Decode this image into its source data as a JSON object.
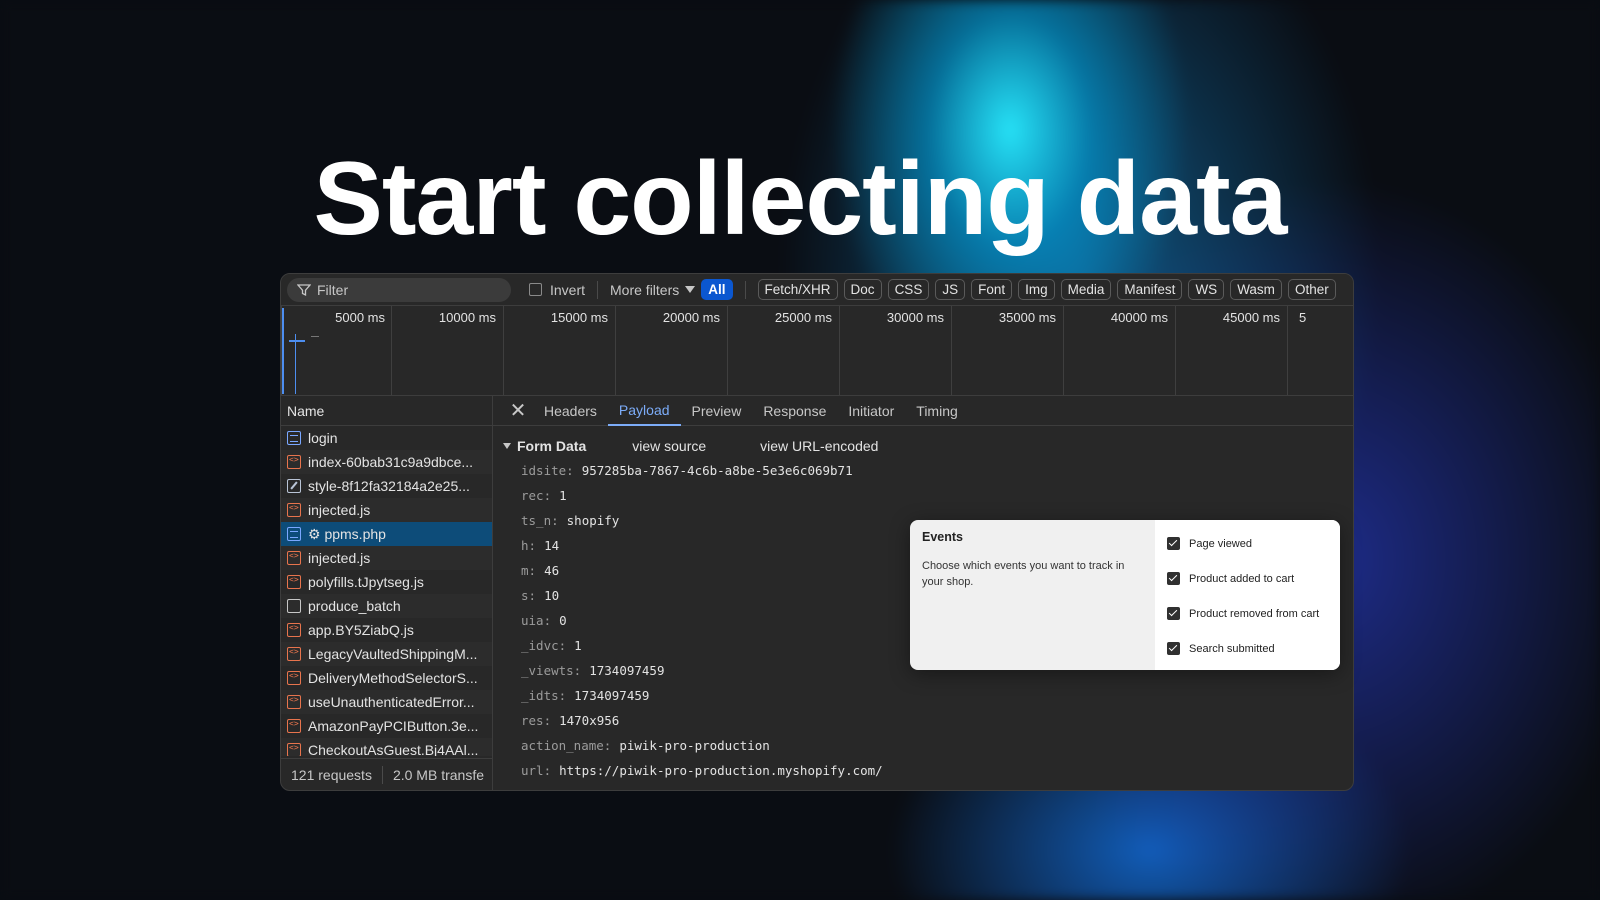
{
  "headline": "Start collecting data",
  "toolbar": {
    "filter_placeholder": "Filter",
    "invert_label": "Invert",
    "more_filters_label": "More filters",
    "chips": [
      "All",
      "Fetch/XHR",
      "Doc",
      "CSS",
      "JS",
      "Font",
      "Img",
      "Media",
      "Manifest",
      "WS",
      "Wasm",
      "Other"
    ]
  },
  "timeline": {
    "ticks": [
      "5000 ms",
      "10000 ms",
      "15000 ms",
      "20000 ms",
      "25000 ms",
      "30000 ms",
      "35000 ms",
      "40000 ms",
      "45000 ms",
      "5"
    ]
  },
  "requests": {
    "column_name": "Name",
    "items": [
      {
        "name": "login",
        "icon": "document-icon"
      },
      {
        "name": "index-60bab31c9a9dbce...",
        "icon": "script-icon"
      },
      {
        "name": "style-8f12fa32184a2e25...",
        "icon": "stylesheet-icon"
      },
      {
        "name": "injected.js",
        "icon": "script-icon"
      },
      {
        "name": "⚙ ppms.php",
        "icon": "document-icon",
        "selected": true
      },
      {
        "name": "injected.js",
        "icon": "script-icon"
      },
      {
        "name": "polyfills.tJpytseg.js",
        "icon": "script-icon"
      },
      {
        "name": "produce_batch",
        "icon": "blank-icon"
      },
      {
        "name": "app.BY5ZiabQ.js",
        "icon": "script-icon"
      },
      {
        "name": "LegacyVaultedShippingM...",
        "icon": "script-icon"
      },
      {
        "name": "DeliveryMethodSelectorS...",
        "icon": "script-icon"
      },
      {
        "name": "useUnauthenticatedError...",
        "icon": "script-icon"
      },
      {
        "name": "AmazonPayPCIButton.3e...",
        "icon": "script-icon"
      },
      {
        "name": "CheckoutAsGuest.Bj4AAl...",
        "icon": "script-icon"
      }
    ],
    "status_requests": "121 requests",
    "status_transferred": "2.0 MB transfe"
  },
  "detail": {
    "tabs": [
      "Headers",
      "Payload",
      "Preview",
      "Response",
      "Initiator",
      "Timing"
    ],
    "active_tab": "Payload",
    "form_data_title": "Form Data",
    "view_source": "view source",
    "view_url_encoded": "view URL-encoded",
    "fields": [
      {
        "key": "idsite:",
        "value": "957285ba-7867-4c6b-a8be-5e3e6c069b71"
      },
      {
        "key": "rec:",
        "value": "1"
      },
      {
        "key": "ts_n:",
        "value": "shopify"
      },
      {
        "key": "h:",
        "value": "14"
      },
      {
        "key": "m:",
        "value": "46"
      },
      {
        "key": "s:",
        "value": "10"
      },
      {
        "key": "uia:",
        "value": "0"
      },
      {
        "key": "_idvc:",
        "value": "1"
      },
      {
        "key": "_viewts:",
        "value": "1734097459"
      },
      {
        "key": "_idts:",
        "value": "1734097459"
      },
      {
        "key": "res:",
        "value": "1470x956"
      },
      {
        "key": "action_name:",
        "value": "piwik-pro-production"
      },
      {
        "key": "url:",
        "value": "https://piwik-pro-production.myshopify.com/"
      }
    ]
  },
  "events_card": {
    "title": "Events",
    "description": "Choose which events you want to track in your shop.",
    "options": [
      {
        "label": "Page viewed",
        "checked": true
      },
      {
        "label": "Product added to cart",
        "checked": true
      },
      {
        "label": "Product removed from cart",
        "checked": true
      },
      {
        "label": "Search submitted",
        "checked": true
      }
    ]
  }
}
